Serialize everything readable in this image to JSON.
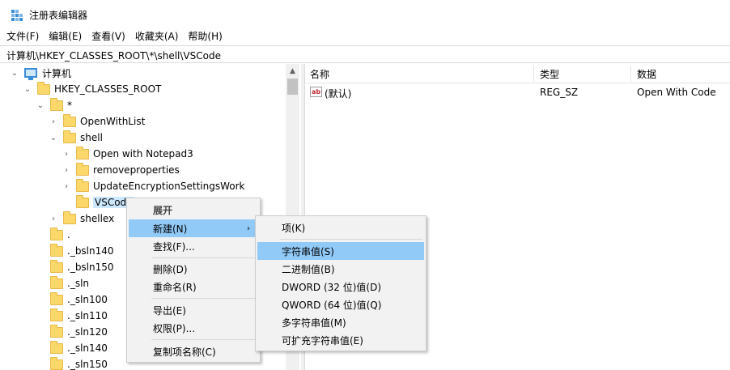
{
  "window": {
    "title": "注册表编辑器"
  },
  "menubar": [
    "文件(F)",
    "编辑(E)",
    "查看(V)",
    "收藏夹(A)",
    "帮助(H)"
  ],
  "address": "计算机\\HKEY_CLASSES_ROOT\\*\\shell\\VSCode",
  "tree": {
    "computer": "计算机",
    "hkcr": "HKEY_CLASSES_ROOT",
    "star": "*",
    "openwithlist": "OpenWithList",
    "shell": "shell",
    "notepad3": "Open with Notepad3",
    "removeproperties": "removeproperties",
    "updateenc": "UpdateEncryptionSettingsWork",
    "vscode": "VSCode",
    "shellex": "shellex",
    "dot": ".",
    "bsln140": "._bsln140",
    "bsln150": "._bsln150",
    "sln": "._sln",
    "sln100": "._sln100",
    "sln110": "._sln110",
    "sln120": "._sln120",
    "sln140": "._sln140",
    "sln150": "._sln150"
  },
  "list": {
    "headers": {
      "name": "名称",
      "type": "类型",
      "data": "数据"
    },
    "rows": [
      {
        "name": "(默认)",
        "type": "REG_SZ",
        "data": "Open With Code",
        "icon_text": "ab"
      }
    ]
  },
  "context_menu": {
    "expand": "展开",
    "new": "新建(N)",
    "find": "查找(F)...",
    "delete": "删除(D)",
    "rename": "重命名(R)",
    "export": "导出(E)",
    "permissions": "权限(P)...",
    "copy_key_name": "复制项名称(C)"
  },
  "submenu": {
    "key": "项(K)",
    "string": "字符串值(S)",
    "binary": "二进制值(B)",
    "dword": "DWORD (32 位)值(D)",
    "qword": "QWORD (64 位)值(Q)",
    "multi_string": "多字符串值(M)",
    "expandable_string": "可扩充字符串值(E)"
  },
  "colors": {
    "hover": "#91c9f7",
    "selected": "#cce8ff",
    "folder": "#fcd86b",
    "icon_blue": "#3b8ed8"
  },
  "icons": {
    "app": "registry-icon",
    "computer": "computer-icon",
    "folder": "folder-icon",
    "value": "string-value-icon"
  }
}
